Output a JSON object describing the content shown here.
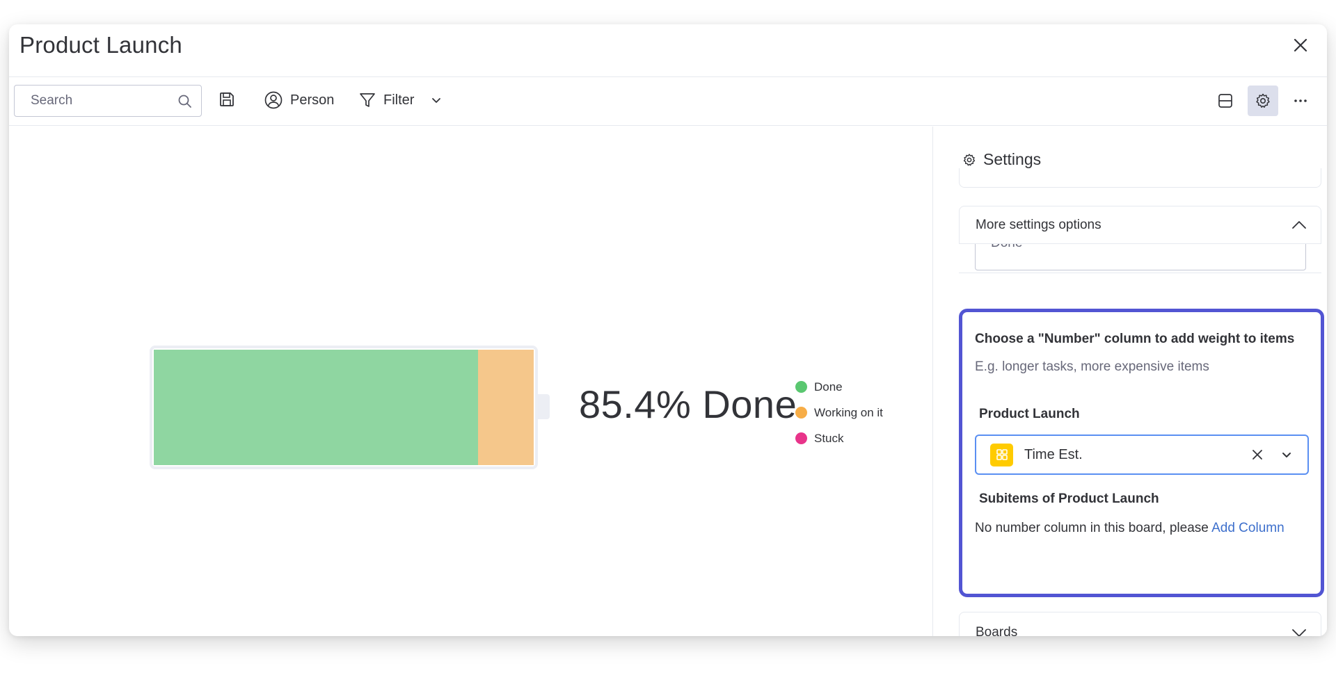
{
  "header": {
    "title": "Product Launch"
  },
  "toolbar": {
    "search_placeholder": "Search",
    "person_label": "Person",
    "filter_label": "Filter"
  },
  "widget": {
    "percent_label": "85.4% Done",
    "segments": [
      {
        "name": "Done",
        "fraction": 0.854,
        "color": "#8fd6a1"
      },
      {
        "name": "Working on it",
        "fraction": 0.146,
        "color": "#f5c78b"
      },
      {
        "name": "Stuck",
        "fraction": 0.0,
        "color": "#e8348a"
      }
    ],
    "legend": [
      {
        "label": "Done",
        "color": "#5ac770"
      },
      {
        "label": "Working on it",
        "color": "#f7ad47"
      },
      {
        "label": "Stuck",
        "color": "#e8348a"
      }
    ]
  },
  "settings": {
    "title": "Settings",
    "more_options_label": "More settings options",
    "cut_field_text": "Done",
    "weight": {
      "heading": "Choose a \"Number\" column to add weight to items",
      "subheading": "E.g. longer tasks, more expensive items",
      "board_label": "Product Launch",
      "selected_column": "Time Est.",
      "subitems_label": "Subitems of Product Launch",
      "no_column_text": "No number column in this board, please ",
      "add_column_link": "Add Column"
    },
    "boards_label": "Boards"
  }
}
